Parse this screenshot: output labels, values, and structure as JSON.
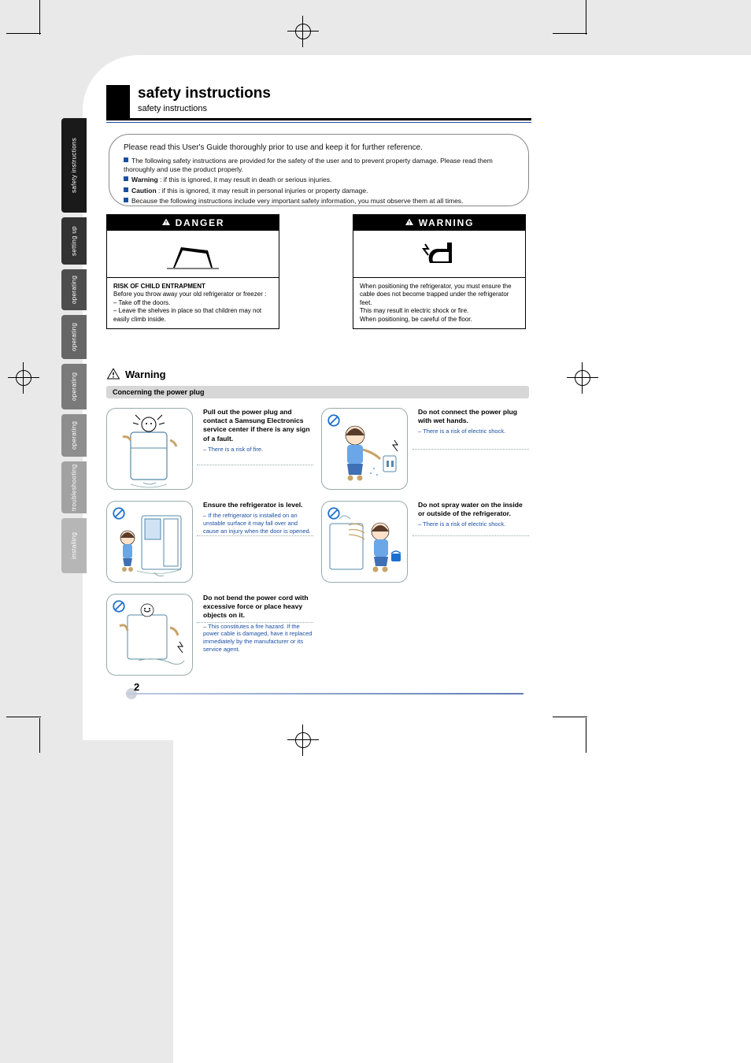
{
  "page_number": "2",
  "header": {
    "title": "safety instructions",
    "subtitle": "safety instructions",
    "tabs": [
      "safety instructions",
      "setting up",
      "operating",
      "operating",
      "operating",
      "operating",
      "troubleshooting",
      "installing"
    ]
  },
  "intro": {
    "lead": "Please read this User's Guide thoroughly prior to use and keep it for further reference.",
    "bullet1": "The following safety instructions are provided for the safety of the user and to prevent property damage. Please read them thoroughly and use the product properly.",
    "bullet2_label": "Warning",
    "bullet2_text": ": if this is ignored, it may result in death or serious injuries.",
    "bullet3_label": "Caution",
    "bullet3_text": ": if this is ignored, it may result in personal injuries or property damage.",
    "bullet4": "Because the following instructions include very important safety information, you must observe them at all times."
  },
  "danger": {
    "label": "DANGER",
    "line1": "RISK OF CHILD ENTRAPMENT",
    "line2": "Before you throw away your old refrigerator or freezer :",
    "line3": "– Take off the doors.",
    "line4": "– Leave the shelves in place so that children may not easily climb inside."
  },
  "warning": {
    "label": "WARNING",
    "line1": "When positioning the refrigerator, you must ensure the cable does not become trapped under the refrigerator feet.",
    "line2": "This may result in electric shock or fire.",
    "line3": "When positioning, be careful of the floor."
  },
  "subheader": {
    "warn_word": "Warning",
    "bar": "Concerning the power plug"
  },
  "tips": {
    "A": {
      "h": "Pull out the power plug and contact a Samsung Electronics service center if there is any sign of a fault.",
      "sub": "– There is a risk of fire."
    },
    "B": {
      "h": "Ensure the refrigerator is level.",
      "sub": "– If the refrigerator is installed on an unstable surface it may fall over and cause an injury when the door is opened."
    },
    "C": {
      "h": "Do not bend the power cord with excessive force or place heavy objects on it.",
      "sub": "– This constitutes a fire hazard. If the power cable is damaged, have it replaced immediately by the manufacturer or its service agent."
    },
    "D": {
      "h": "Do not connect the power plug with wet hands.",
      "sub": "– There is a risk of electric shock."
    },
    "E": {
      "h": "Do not spray water on the inside or outside of the refrigerator.",
      "sub": "– There is a risk of electric shock."
    }
  },
  "icons": {
    "prohibit": "prohibit-icon",
    "alert": "alert-triangle-icon",
    "hand_shock": "hand-shock-icon",
    "book": "manual-book-icon"
  }
}
